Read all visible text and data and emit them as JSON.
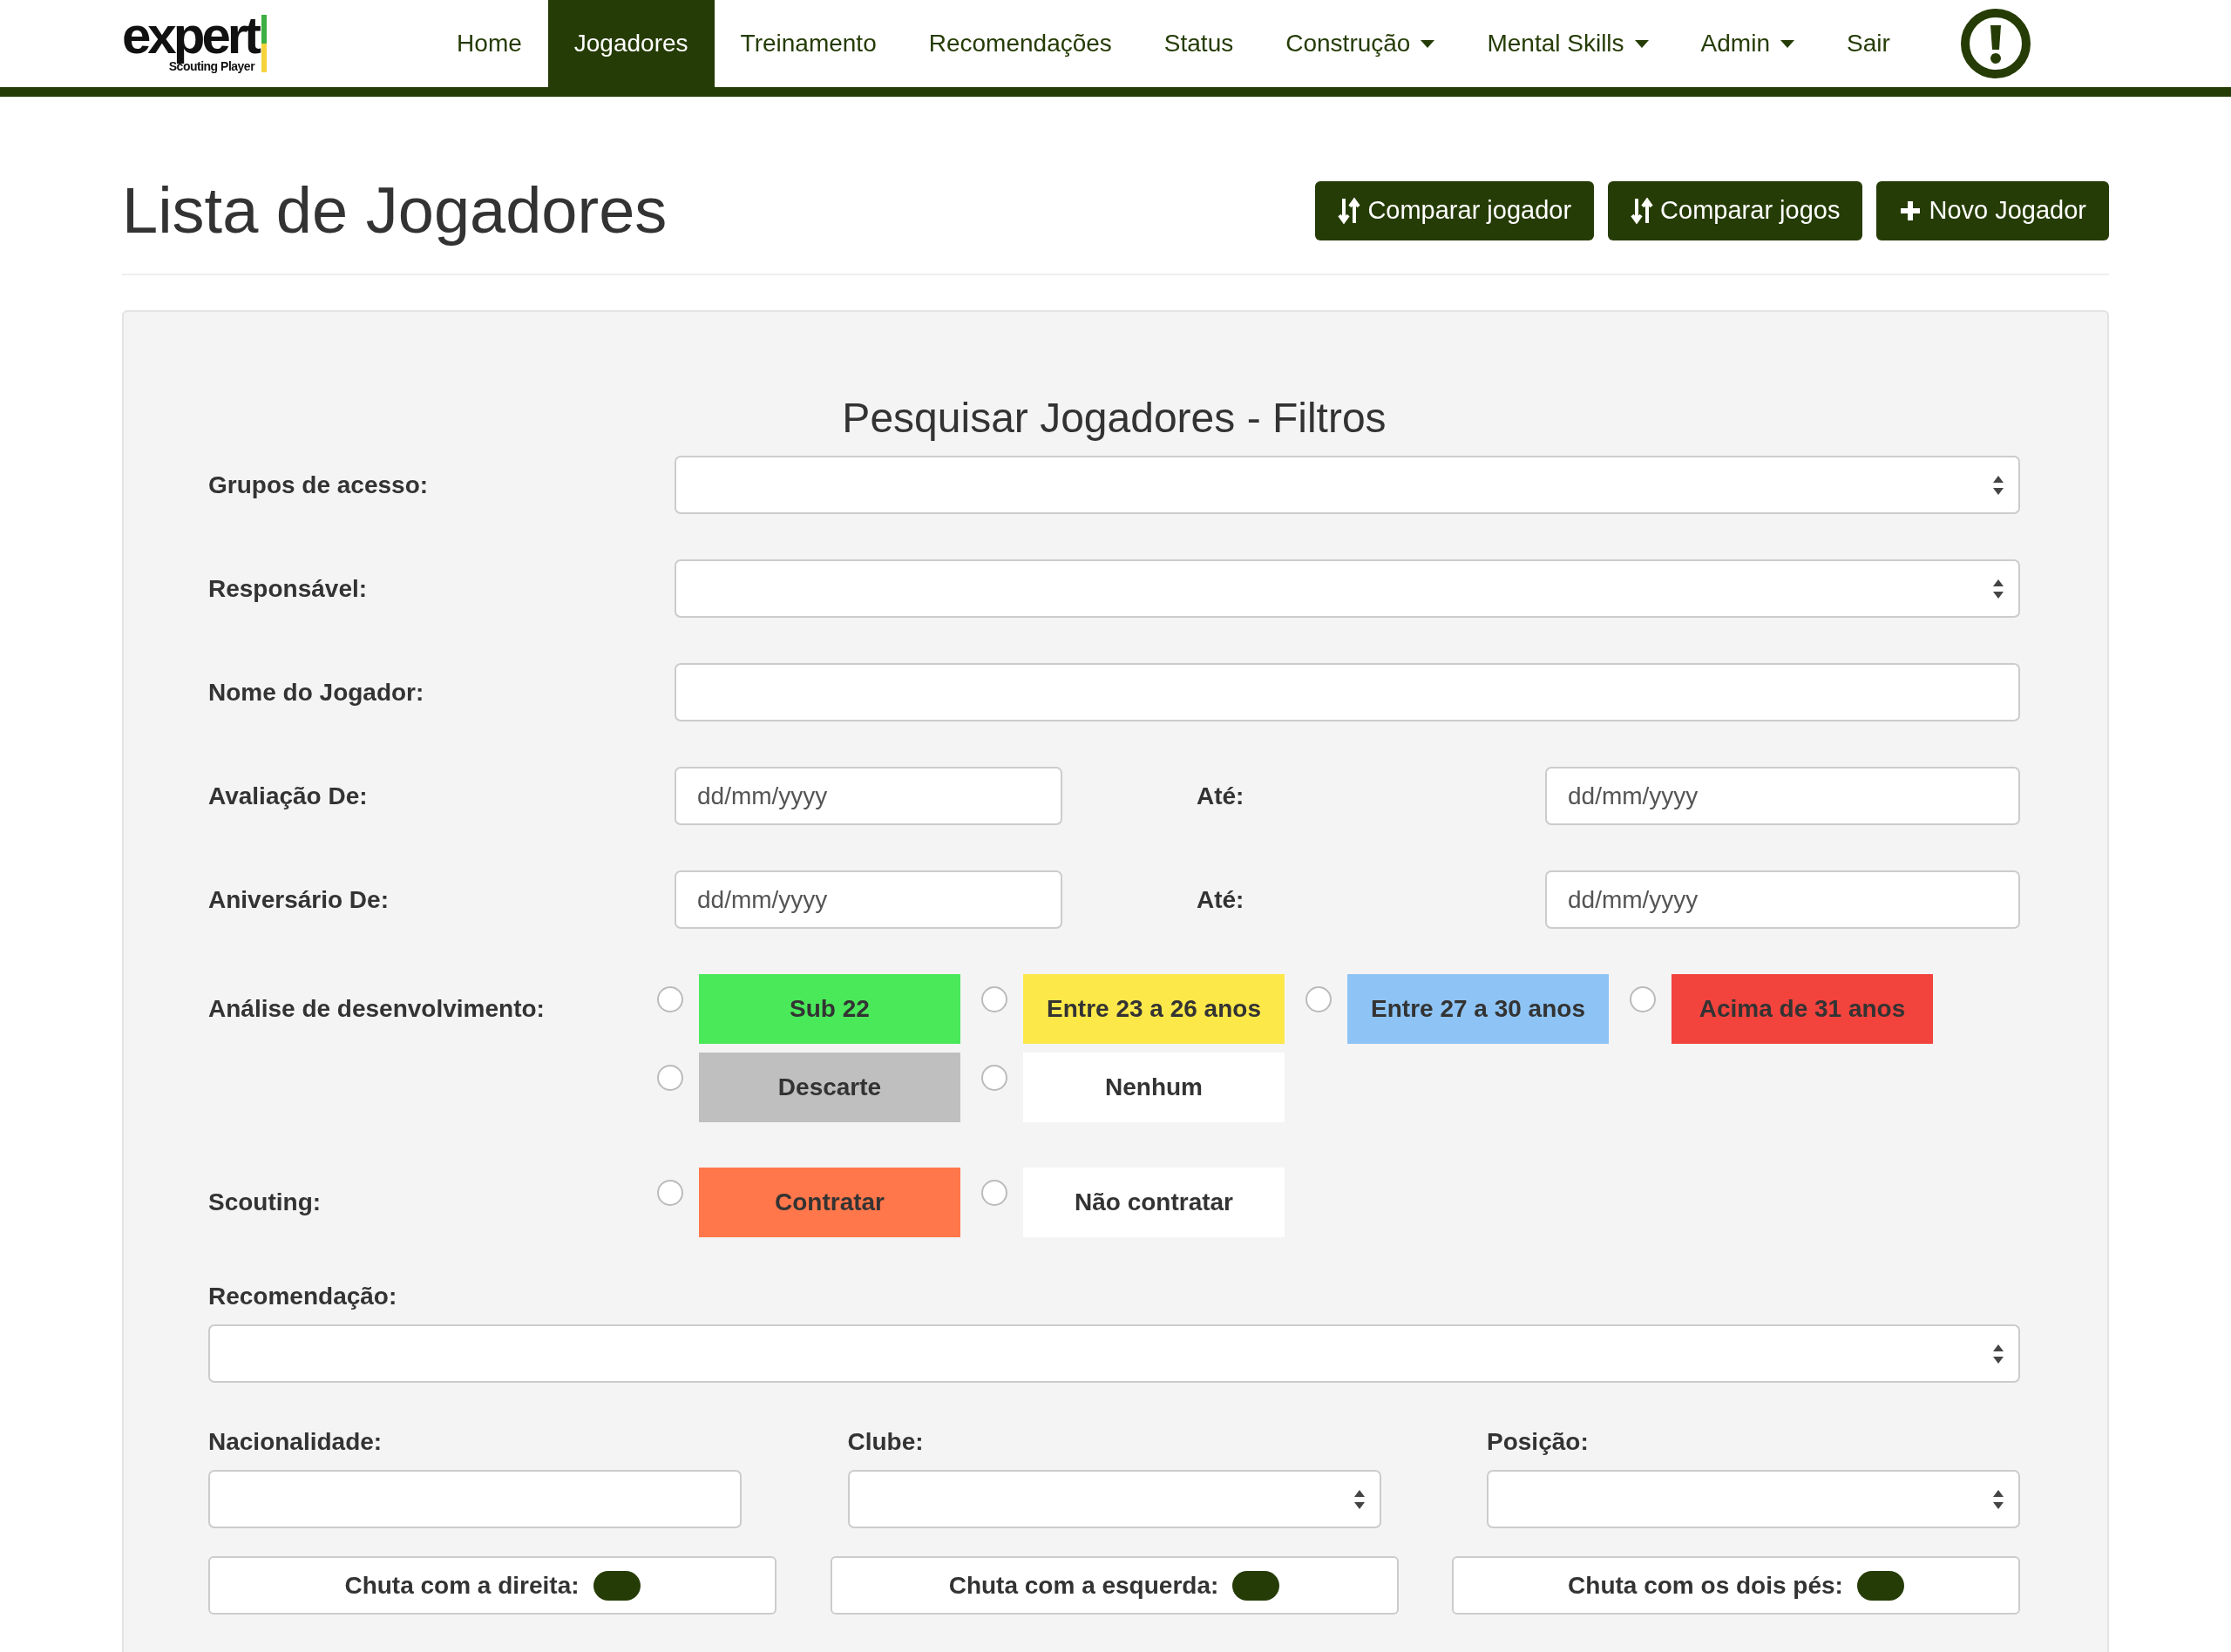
{
  "navbar": {
    "logo": {
      "wordmark": "expert",
      "tagline": "Scouting Player"
    },
    "items": [
      {
        "label": "Home",
        "selected": false,
        "dropdown": false
      },
      {
        "label": "Jogadores",
        "selected": true,
        "dropdown": false
      },
      {
        "label": "Treinamento",
        "selected": false,
        "dropdown": false
      },
      {
        "label": "Recomendações",
        "selected": false,
        "dropdown": false
      },
      {
        "label": "Status",
        "selected": false,
        "dropdown": false
      },
      {
        "label": "Construção",
        "selected": false,
        "dropdown": true
      },
      {
        "label": "Mental Skills",
        "selected": false,
        "dropdown": true
      },
      {
        "label": "Admin",
        "selected": false,
        "dropdown": true
      },
      {
        "label": "Sair",
        "selected": false,
        "dropdown": false
      }
    ]
  },
  "page_title": "Lista de Jogadores",
  "actions": [
    {
      "label": "Comparar jogador",
      "kind": "sort"
    },
    {
      "label": "Comparar jogos",
      "kind": "sort"
    },
    {
      "label": "Novo Jogador",
      "kind": "add"
    }
  ],
  "filters": {
    "title": "Pesquisar Jogadores - Filtros",
    "rows": [
      {
        "kind": "select",
        "label": "Grupos de acesso:"
      },
      {
        "kind": "select",
        "label": "Responsável:"
      },
      {
        "kind": "text",
        "label": "Nome do Jogador:"
      },
      {
        "kind": "daterange",
        "label": "Avaliação De:",
        "from_placeholder": "dd/mm/yyyy",
        "to_label": "Até:",
        "to_placeholder": "dd/mm/yyyy"
      },
      {
        "kind": "daterange",
        "label": "Aniversário De:",
        "from_placeholder": "dd/mm/yyyy",
        "to_label": "Até:",
        "to_placeholder": "dd/mm/yyyy"
      },
      {
        "kind": "radios",
        "label": "Análise de desenvolvimento:",
        "options": [
          {
            "label": "Sub 22",
            "color": "#4ae95a",
            "selected": false
          },
          {
            "label": "Entre 23 a 26 anos",
            "color": "#fde84a",
            "selected": false
          },
          {
            "label": "Entre 27 a 30 anos",
            "color": "#8ec4f5",
            "selected": false
          },
          {
            "label": "Acima de 31 anos",
            "color": "#f2433d",
            "selected": false
          },
          {
            "label": "Descarte",
            "color": "#bfbfbf",
            "selected": false
          },
          {
            "label": "Nenhum",
            "color": "#ffffff",
            "selected": false
          }
        ]
      },
      {
        "kind": "radios",
        "label": "Scouting:",
        "options": [
          {
            "label": "Contratar",
            "color": "#ff774a",
            "selected": false
          },
          {
            "label": "Não contratar",
            "color": "#ffffff",
            "selected": false
          }
        ]
      }
    ],
    "recommendation": {
      "label": "Recomendação:"
    },
    "columns": [
      {
        "kind": "text",
        "label": "Nacionalidade:"
      },
      {
        "kind": "select",
        "label": "Clube:"
      },
      {
        "kind": "select",
        "label": "Posição:"
      }
    ],
    "toggles": [
      {
        "label": "Chuta com a direita:",
        "on": true
      },
      {
        "label": "Chuta com a esquerda:",
        "on": true
      },
      {
        "label": "Chuta com os dois pés:",
        "on": true
      }
    ]
  }
}
